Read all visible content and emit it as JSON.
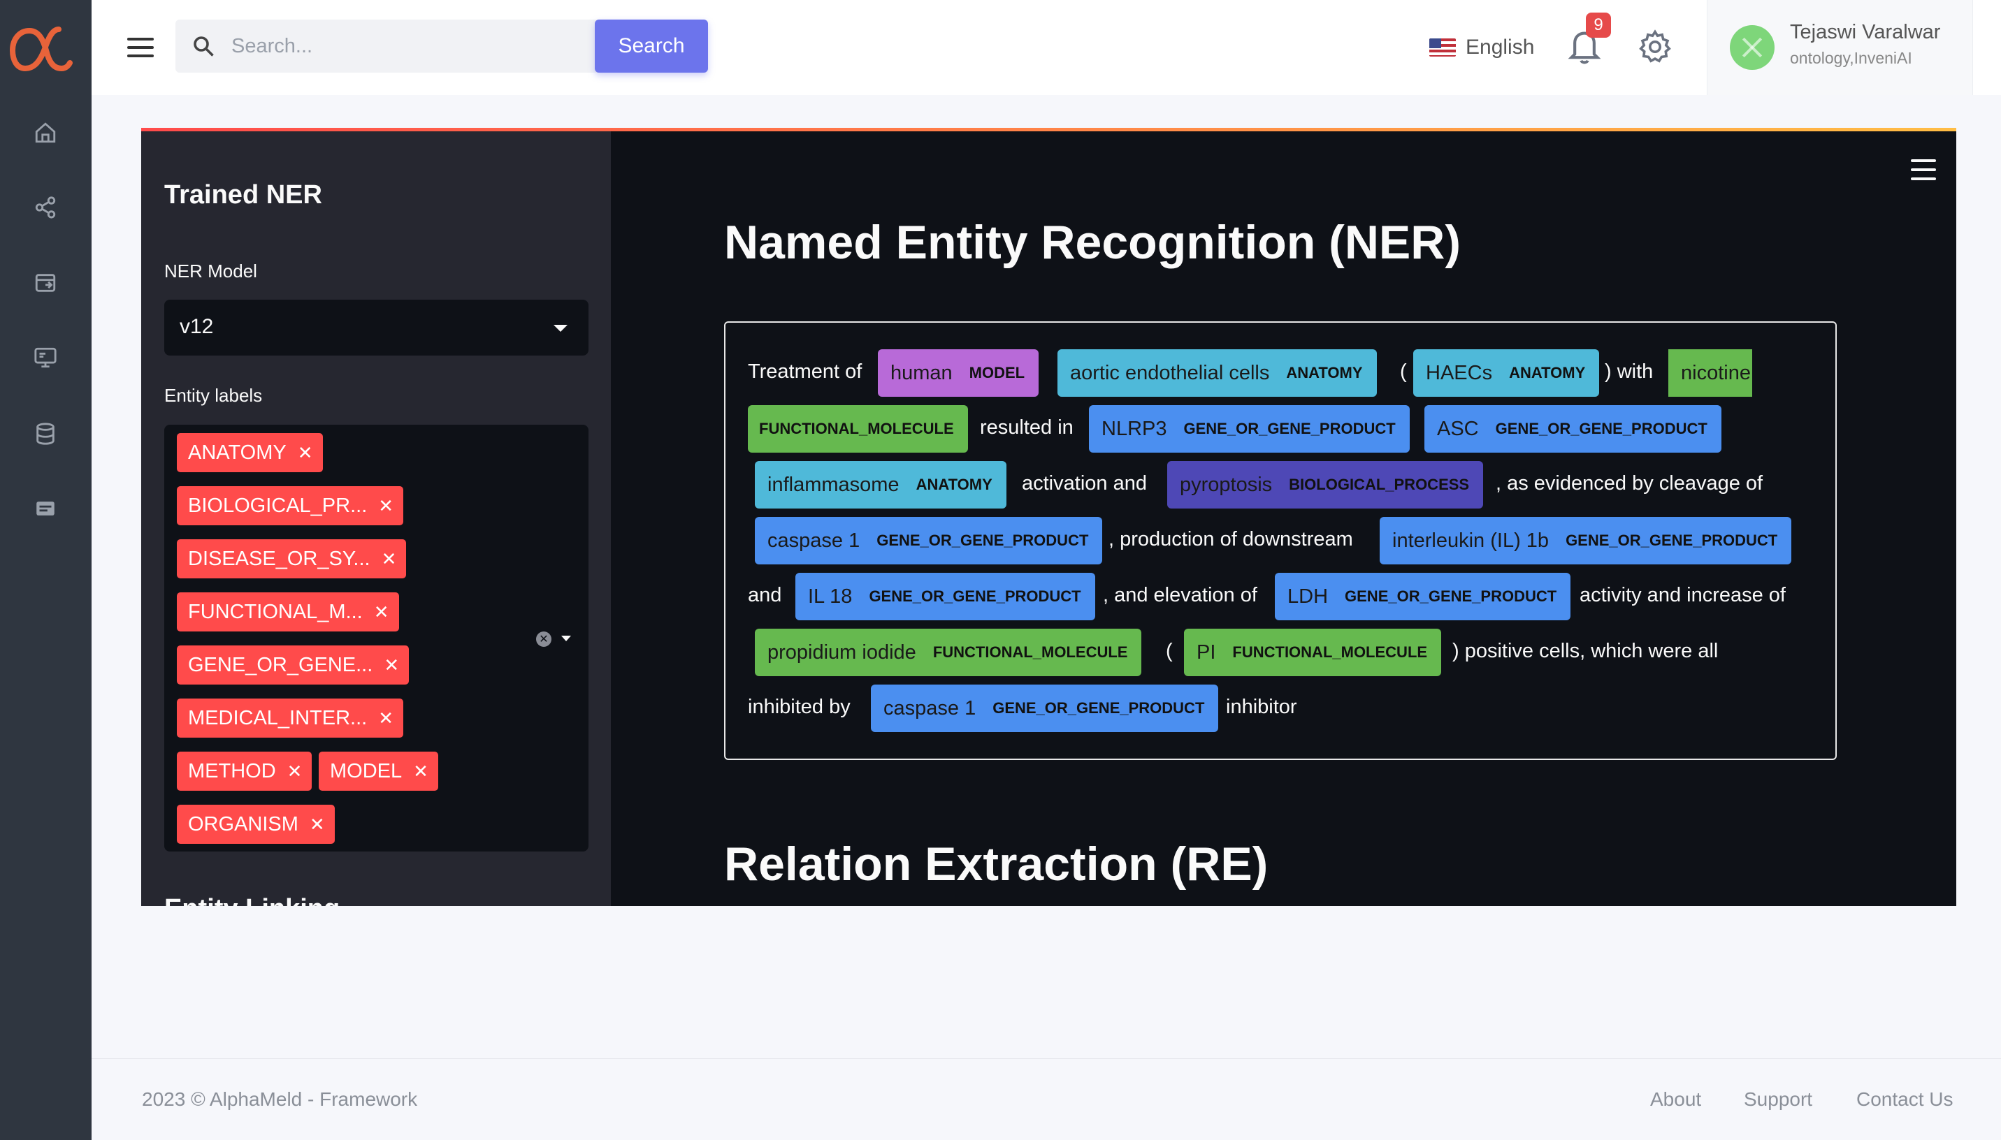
{
  "header": {
    "search_placeholder": "Search...",
    "search_button": "Search",
    "language": "English",
    "notification_count": "9",
    "user_name": "Tejaswi Varalwar",
    "user_org": "ontology,InveniAI"
  },
  "sidebar_nav": {
    "icons": [
      "home-icon",
      "share-icon",
      "export-icon",
      "monitor-icon",
      "database-icon",
      "message-icon"
    ]
  },
  "panel": {
    "sidebar": {
      "title": "Trained NER",
      "model_label": "NER Model",
      "model_value": "v12",
      "labels_label": "Entity labels",
      "chips": [
        "ANATOMY",
        "BIOLOGICAL_PR...",
        "DISEASE_OR_SY...",
        "FUNCTIONAL_M...",
        "GENE_OR_GENE...",
        "MEDICAL_INTER...",
        "METHOD",
        "MODEL",
        "ORGANISM"
      ],
      "next_heading": "Entity Linking"
    },
    "main": {
      "title": "Named Entity Recognition (NER)",
      "re_title": "Relation Extraction (RE)",
      "ner_text": {
        "t0": "Treatment of",
        "e0": {
          "text": "human",
          "label": "MODEL"
        },
        "e1": {
          "text": "aortic endothelial cells",
          "label": "ANATOMY"
        },
        "t1": "(",
        "e2": {
          "text": "HAECs",
          "label": "ANATOMY"
        },
        "t2": ") with",
        "e3": {
          "text": "nicotine",
          "label": "FUNCTIONAL_MOLECULE"
        },
        "t3": "resulted in",
        "e4": {
          "text": "NLRP3",
          "label": "GENE_OR_GENE_PRODUCT"
        },
        "e5": {
          "text": "ASC",
          "label": "GENE_OR_GENE_PRODUCT"
        },
        "e6": {
          "text": "inflammasome",
          "label": "ANATOMY"
        },
        "t4": "activation and",
        "e7": {
          "text": "pyroptosis",
          "label": "BIOLOGICAL_PROCESS"
        },
        "t5": ", as evidenced by cleavage of",
        "e8": {
          "text": "caspase 1",
          "label": "GENE_OR_GENE_PRODUCT"
        },
        "t6": ", production of downstream",
        "e9": {
          "text": "interleukin (IL) 1b",
          "label": "GENE_OR_GENE_PRODUCT"
        },
        "t7": "and",
        "e10": {
          "text": "IL 18",
          "label": "GENE_OR_GENE_PRODUCT"
        },
        "t8": ", and elevation of",
        "e11": {
          "text": "LDH",
          "label": "GENE_OR_GENE_PRODUCT"
        },
        "t9": "activity and increase of",
        "e12": {
          "text": "propidium iodide",
          "label": "FUNCTIONAL_MOLECULE"
        },
        "t10": "(",
        "e13": {
          "text": "PI",
          "label": "FUNCTIONAL_MOLECULE"
        },
        "t11": ") positive cells, which were all",
        "t12": "inhibited by",
        "e14": {
          "text": "caspase 1",
          "label": "GENE_OR_GENE_PRODUCT"
        },
        "t13": "inhibitor"
      }
    }
  },
  "colors": {
    "MODEL": "#b86ad8",
    "ANATOMY": "#4fb9d9",
    "FUNCTIONAL_MOLECULE": "#66b94f",
    "GENE_OR_GENE_PRODUCT": "#4b8ff0",
    "BIOLOGICAL_PROCESS": "#4e48b6",
    "chip": "#ff4b4b",
    "accent": "#6c74ec"
  },
  "footer": {
    "copyright": "2023 © AlphaMeld - Framework",
    "links": [
      "About",
      "Support",
      "Contact Us"
    ]
  }
}
